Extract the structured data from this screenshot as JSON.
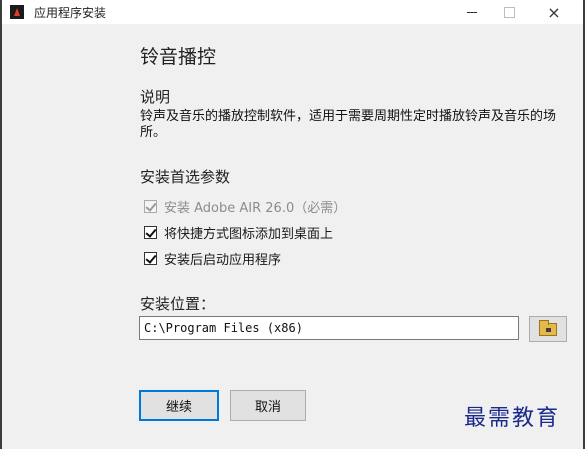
{
  "window": {
    "title": "应用程序安装",
    "icon": "adobe-air-icon",
    "controls": {
      "minimize": "–",
      "maximize": "□",
      "close": "×"
    }
  },
  "app": {
    "name": "铃音播控"
  },
  "description": {
    "heading": "说明",
    "text": "铃声及音乐的播放控制软件，适用于需要周期性定时播放铃声及音乐的场所。"
  },
  "preferences": {
    "heading": "安装首选参数",
    "options": [
      {
        "label": "安装 Adobe AIR 26.0（必需）",
        "checked": true,
        "disabled": true
      },
      {
        "label": "将快捷方式图标添加到桌面上",
        "checked": true,
        "disabled": false
      },
      {
        "label": "安装后启动应用程序",
        "checked": true,
        "disabled": false
      }
    ]
  },
  "location": {
    "label": "安装位置：",
    "value": "C:\\Program Files (x86)",
    "browse_icon": "folder-icon"
  },
  "buttons": {
    "continue": "继续",
    "cancel": "取消"
  },
  "watermark": "最需教育",
  "colors": {
    "focus_border": "#0078d7",
    "watermark": "#1a2a8c"
  }
}
